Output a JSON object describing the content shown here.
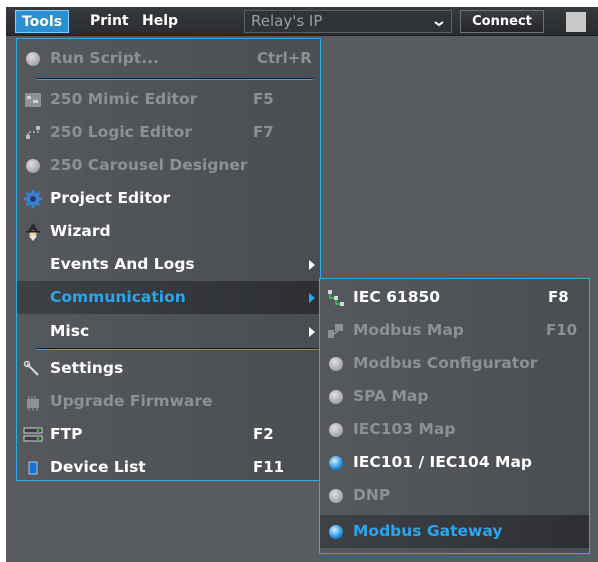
{
  "menubar": {
    "tools": "Tools",
    "print": "Print",
    "help": "Help",
    "ip_value": "Relay's IP",
    "connect": "Connect"
  },
  "tools_menu": {
    "run_script": {
      "label": "Run Script...",
      "shortcut": "Ctrl+R",
      "icon": "sphere-icon"
    },
    "mimic_editor": {
      "label": "250 Mimic Editor",
      "shortcut": "F5",
      "icon": "mimic-icon"
    },
    "logic_editor": {
      "label": "250 Logic Editor",
      "shortcut": "F7",
      "icon": "logic-icon"
    },
    "carousel_designer": {
      "label": "250 Carousel Designer",
      "icon": "sphere-icon"
    },
    "project_editor": {
      "label": "Project Editor",
      "icon": "gear-icon"
    },
    "wizard": {
      "label": "Wizard",
      "icon": "wizard-icon"
    },
    "events_logs": {
      "label": "Events And Logs"
    },
    "communication": {
      "label": "Communication"
    },
    "misc": {
      "label": "Misc"
    },
    "settings": {
      "label": "Settings",
      "icon": "wrench-icon"
    },
    "upgrade_firmware": {
      "label": "Upgrade Firmware",
      "icon": "firmware-icon"
    },
    "ftp": {
      "label": "FTP",
      "shortcut": "F2",
      "icon": "server-icon"
    },
    "device_list": {
      "label": "Device List",
      "shortcut": "F11",
      "icon": "device-icon"
    }
  },
  "comm_menu": {
    "iec61850": {
      "label": "IEC 61850",
      "shortcut": "F8",
      "icon": "network-icon"
    },
    "modbus_map": {
      "label": "Modbus Map",
      "shortcut": "F10",
      "icon": "map-icon"
    },
    "modbus_configurator": {
      "label": "Modbus Configurator",
      "icon": "sphere-icon"
    },
    "spa_map": {
      "label": "SPA Map",
      "icon": "sphere-icon"
    },
    "iec103_map": {
      "label": "IEC103 Map",
      "icon": "sphere-icon"
    },
    "iec101_104_map": {
      "label": "IEC101 / IEC104 Map",
      "icon": "sphere-icon"
    },
    "dnp": {
      "label": "DNP",
      "icon": "sphere-icon"
    },
    "modbus_gateway": {
      "label": "Modbus Gateway",
      "icon": "sphere-icon"
    }
  },
  "colors": {
    "accent": "#2aa6ef",
    "disabled_text": "#8d9095",
    "menu_bg": "#505357",
    "app_bg": "#585b60"
  }
}
